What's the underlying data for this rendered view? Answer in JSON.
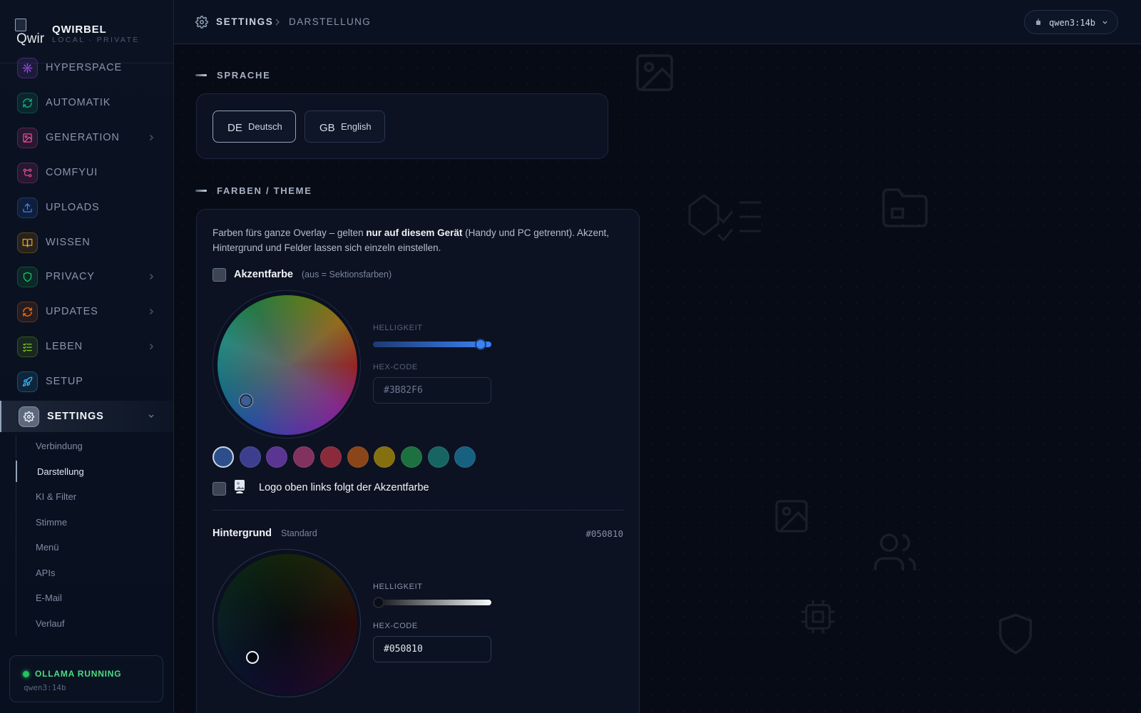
{
  "brand": {
    "name": "QWIRBEL",
    "subtitle": "LOCAL · PRIVATE",
    "logo_alt": "Qwir"
  },
  "sidebar": {
    "items": [
      {
        "label": "HYPERSPACE",
        "icon": "sparkle-icon",
        "color": "#a855f7",
        "has_chevron": false
      },
      {
        "label": "AUTOMATIK",
        "icon": "refresh-icon",
        "color": "#10b981",
        "has_chevron": false
      },
      {
        "label": "GENERATION",
        "icon": "image-icon",
        "color": "#ec4899",
        "has_chevron": true
      },
      {
        "label": "COMFYUI",
        "icon": "workflow-icon",
        "color": "#ec4899",
        "has_chevron": false
      },
      {
        "label": "UPLOADS",
        "icon": "upload-icon",
        "color": "#3b82f6",
        "has_chevron": false
      },
      {
        "label": "WISSEN",
        "icon": "book-icon",
        "color": "#f59e0b",
        "has_chevron": false
      },
      {
        "label": "PRIVACY",
        "icon": "shield-icon",
        "color": "#22c55e",
        "has_chevron": true
      },
      {
        "label": "UPDATES",
        "icon": "refresh-icon",
        "color": "#f97316",
        "has_chevron": true
      },
      {
        "label": "LEBEN",
        "icon": "checklist-icon",
        "color": "#84cc16",
        "has_chevron": true
      },
      {
        "label": "SETUP",
        "icon": "rocket-icon",
        "color": "#38bdf8",
        "has_chevron": false
      },
      {
        "label": "SETTINGS",
        "icon": "gear-icon",
        "color": "#94a3b8",
        "has_chevron": true,
        "active": true
      }
    ],
    "subitems": [
      {
        "label": "Verbindung"
      },
      {
        "label": "Darstellung",
        "active": true
      },
      {
        "label": "KI & Filter"
      },
      {
        "label": "Stimme"
      },
      {
        "label": "Menü"
      },
      {
        "label": "APIs"
      },
      {
        "label": "E-Mail"
      },
      {
        "label": "Verlauf"
      }
    ],
    "status": {
      "title": "OLLAMA RUNNING",
      "model": "qwen3:14b"
    }
  },
  "header": {
    "breadcrumb": [
      "SETTINGS",
      "DARSTELLUNG"
    ],
    "model": "qwen3:14b"
  },
  "language": {
    "section_title": "SPRACHE",
    "options": [
      {
        "flag": "DE",
        "label": "Deutsch",
        "active": true
      },
      {
        "flag": "GB",
        "label": "English",
        "active": false
      }
    ]
  },
  "theme": {
    "section_title": "FARBEN / THEME",
    "desc_pre": "Farben fürs ganze Overlay – gelten ",
    "desc_bold": "nur auf diesem Gerät",
    "desc_post": " (Handy und PC getrennt). Akzent, Hintergrund und Felder lassen sich einzeln einstellen.",
    "accent": {
      "label": "Akzentfarbe",
      "hint": "(aus = Sektionsfarben)",
      "checked": false,
      "brightness_label": "HELLIGKEIT",
      "brightness": 0.96,
      "hex_label": "HEX-CODE",
      "hex": "#3B82F6"
    },
    "swatches": [
      "#2c4f8c",
      "#3d3f8e",
      "#5b3592",
      "#82325f",
      "#8b2a3a",
      "#8a4519",
      "#85700f",
      "#1d7040",
      "#166563",
      "#17607f"
    ],
    "logo_follow": {
      "label": "Logo oben links folgt der Akzentfarbe",
      "checked": false
    },
    "background": {
      "label": "Hintergrund",
      "hint": "Standard",
      "hex_display": "#050810",
      "brightness_label": "HELLIGKEIT",
      "brightness": 0.04,
      "hex_label": "HEX-CODE",
      "hex": "#050810"
    }
  }
}
